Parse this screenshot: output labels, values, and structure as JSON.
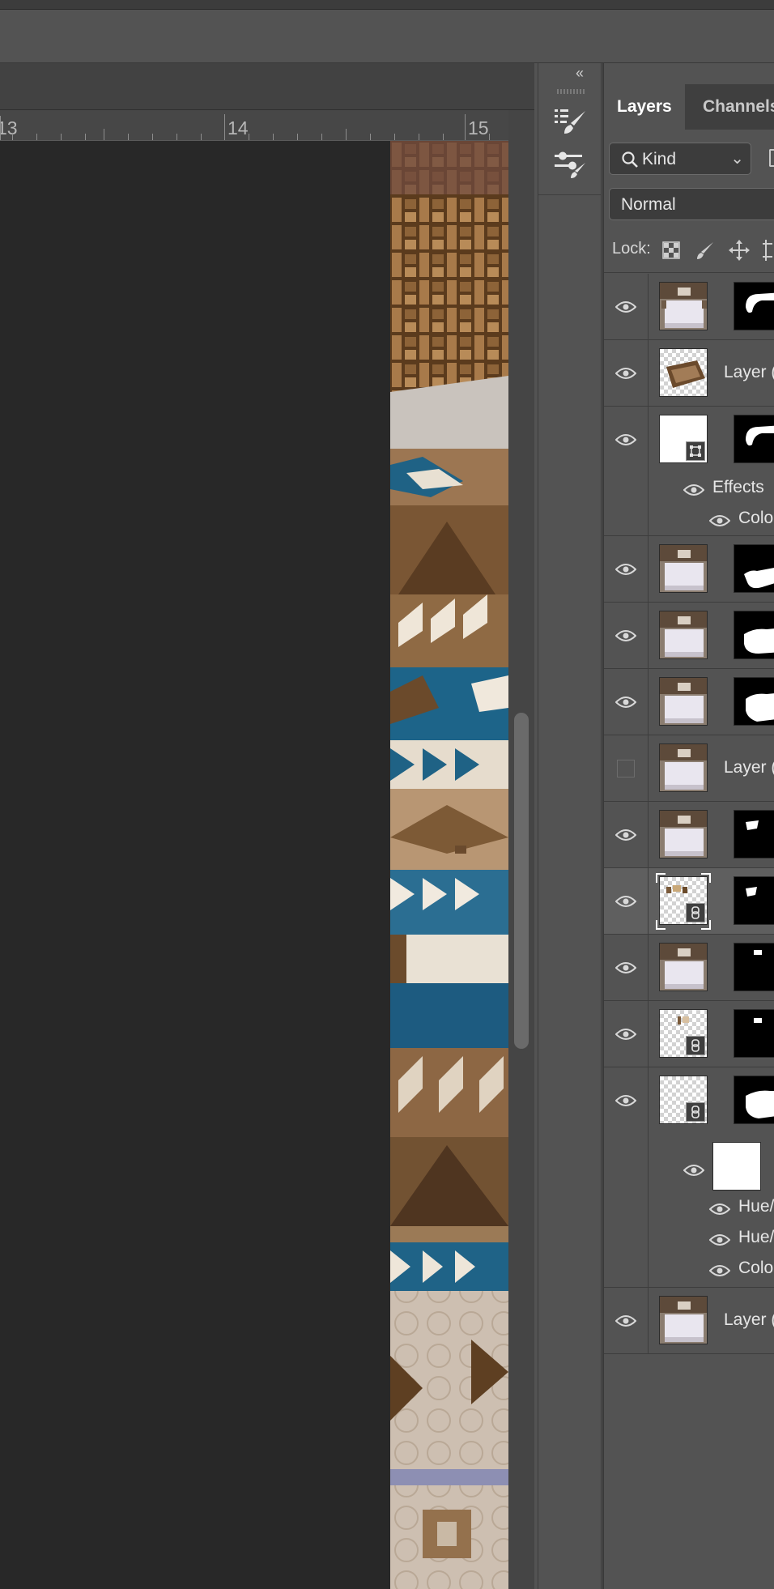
{
  "ruler": {
    "label_13": "13",
    "label_14": "14",
    "label_15": "15"
  },
  "tools_panel": {
    "collapse_glyph": "‹‹"
  },
  "layers_panel": {
    "tabs": [
      "Layers",
      "Channels"
    ],
    "filter": {
      "value": "Kind"
    },
    "blend_mode": "Normal",
    "lock_label": "Lock:",
    "layers": [
      {
        "name": "",
        "visible": true,
        "thumb": "bedroom",
        "mask": "curve-white"
      },
      {
        "name": "Layer (",
        "visible": true,
        "thumb": "rug",
        "mask": "none"
      },
      {
        "name": "",
        "visible": true,
        "thumb": "white-shape",
        "mask": "curve-white",
        "smart_object": true
      },
      {
        "name": "",
        "visible": true,
        "thumb": "bedroom",
        "mask": "blob"
      },
      {
        "name": "",
        "visible": true,
        "thumb": "bedroom",
        "mask": "blob"
      },
      {
        "name": "",
        "visible": true,
        "thumb": "bedroom",
        "mask": "blob"
      },
      {
        "name": "Layer (",
        "visible": false,
        "thumb": "bedroom",
        "mask": "none"
      },
      {
        "name": "",
        "visible": true,
        "thumb": "bedroom",
        "mask": "small"
      },
      {
        "name": "",
        "visible": true,
        "thumb": "transparent",
        "mask": "small",
        "linked": true,
        "selected": true
      },
      {
        "name": "",
        "visible": true,
        "thumb": "bedroom",
        "mask": "small"
      },
      {
        "name": "",
        "visible": true,
        "thumb": "transparent",
        "mask": "small",
        "linked": true
      },
      {
        "name": "",
        "visible": true,
        "thumb": "transparent",
        "mask": "blob",
        "linked": true
      },
      {
        "name": "Layer (",
        "visible": true,
        "thumb": "bedroom",
        "mask": "none"
      }
    ],
    "effects": {
      "label": "Effects",
      "item": "Colo"
    },
    "adjustments": [
      "Hue/",
      "Hue/",
      "Colo"
    ]
  }
}
